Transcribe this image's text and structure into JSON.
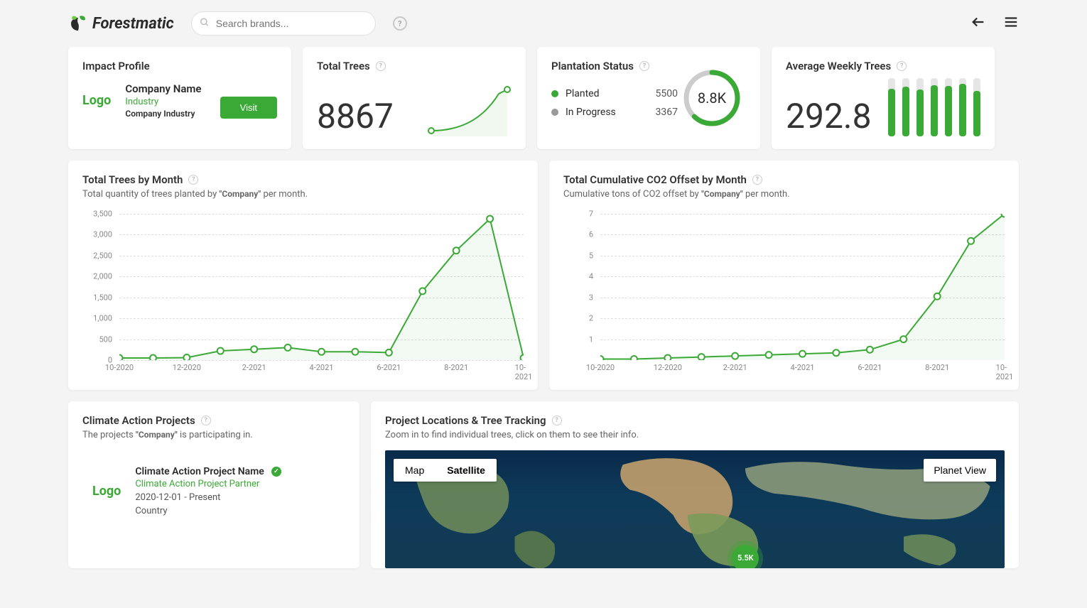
{
  "brand": "Forestmatic",
  "search": {
    "placeholder": "Search brands..."
  },
  "impact": {
    "title": "Impact Profile",
    "logo": "Logo",
    "company_name": "Company Name",
    "industry_label": "Industry",
    "company_industry": "Company Industry",
    "visit_label": "Visit"
  },
  "total_trees": {
    "title": "Total Trees",
    "value": "8867"
  },
  "plantation": {
    "title": "Plantation Status",
    "planted_label": "Planted",
    "planted_value": "5500",
    "inprogress_label": "In Progress",
    "inprogress_value": "3367",
    "donut_label": "8.8K",
    "donut_pct": 62
  },
  "avg_weekly": {
    "title": "Average Weekly Trees",
    "value": "292.8",
    "bars_pct": [
      82,
      85,
      80,
      88,
      86,
      90,
      78
    ]
  },
  "chart1": {
    "title": "Total Trees by Month",
    "subtitle_pre": "Total quantity of trees planted by ",
    "subtitle_company": "\"Company\"",
    "subtitle_post": " per month."
  },
  "chart2": {
    "title": "Total Cumulative CO2 Offset by Month",
    "subtitle_pre": "Cumulative tons of CO2 offset by ",
    "subtitle_company": "\"Company\"",
    "subtitle_post": " per month."
  },
  "projects": {
    "title": "Climate Action Projects",
    "subtitle_pre": "The projects ",
    "subtitle_company": "\"Company\"",
    "subtitle_post": " is participating in.",
    "item": {
      "logo": "Logo",
      "name": "Climate Action Project Name",
      "partner": "Climate Action Project Partner",
      "dates": "2020-12-01 - Present",
      "country": "Country"
    }
  },
  "map": {
    "title": "Project Locations & Tree Tracking",
    "subtitle": "Zoom in to find individual trees, click on them to see their info.",
    "map_label": "Map",
    "sat_label": "Satellite",
    "planet_label": "Planet View",
    "marker_label": "5.5K"
  },
  "chart_data": [
    {
      "type": "line",
      "title": "Total Trees by Month",
      "xlabel": "",
      "ylabel": "",
      "ylim": [
        0,
        3500
      ],
      "y_ticks": [
        0,
        500,
        1000,
        1500,
        2000,
        2500,
        3000,
        3500
      ],
      "x_labels": [
        "10-2020",
        "12-2020",
        "2-2021",
        "4-2021",
        "6-2021",
        "8-2021",
        "10-2021"
      ],
      "categories": [
        "10-2020",
        "11-2020",
        "12-2020",
        "1-2021",
        "2-2021",
        "3-2021",
        "4-2021",
        "5-2021",
        "6-2021",
        "7-2021",
        "8-2021",
        "9-2021",
        "10-2021"
      ],
      "values": [
        50,
        50,
        60,
        220,
        260,
        300,
        200,
        200,
        180,
        1650,
        2620,
        3380,
        50
      ]
    },
    {
      "type": "line",
      "title": "Total Cumulative CO2 Offset by Month",
      "xlabel": "",
      "ylabel": "",
      "ylim": [
        0,
        7
      ],
      "y_ticks": [
        1,
        2,
        3,
        4,
        5,
        6,
        7
      ],
      "x_labels": [
        "10-2020",
        "12-2020",
        "2-2021",
        "4-2021",
        "6-2021",
        "8-2021",
        "10-2021"
      ],
      "categories": [
        "10-2020",
        "11-2020",
        "12-2020",
        "1-2021",
        "2-2021",
        "3-2021",
        "4-2021",
        "5-2021",
        "6-2021",
        "7-2021",
        "8-2021",
        "9-2021",
        "10-2021"
      ],
      "values": [
        0.05,
        0.05,
        0.1,
        0.15,
        0.2,
        0.25,
        0.3,
        0.35,
        0.5,
        1.0,
        3.05,
        5.7,
        7.0
      ]
    }
  ]
}
